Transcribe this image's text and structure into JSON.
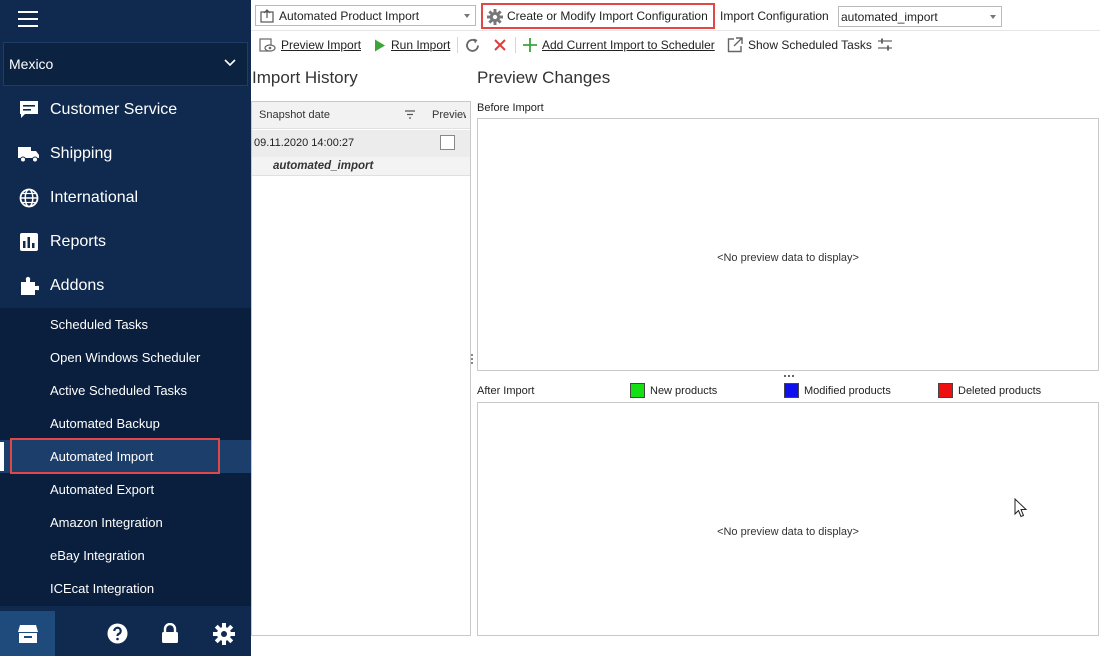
{
  "sidebar": {
    "store": "Mexico",
    "main_items": [
      {
        "label": "Customer Service",
        "icon": "chat-icon"
      },
      {
        "label": "Shipping",
        "icon": "truck-icon"
      },
      {
        "label": "International",
        "icon": "globe-icon"
      },
      {
        "label": "Reports",
        "icon": "bar-chart-icon"
      },
      {
        "label": "Addons",
        "icon": "puzzle-icon"
      }
    ],
    "sub_items": [
      {
        "label": "Scheduled Tasks"
      },
      {
        "label": "Open Windows Scheduler"
      },
      {
        "label": "Active Scheduled Tasks"
      },
      {
        "label": "Automated Backup"
      },
      {
        "label": "Automated Import"
      },
      {
        "label": "Automated Export"
      },
      {
        "label": "Amazon Integration"
      },
      {
        "label": "eBay Integration"
      },
      {
        "label": "ICEcat Integration"
      }
    ],
    "active_sub_item": "Automated Import",
    "bottom_icons": [
      "store-icon",
      "help-icon",
      "lock-icon",
      "gear-icon"
    ]
  },
  "toolbar": {
    "import_select": "Automated Product Import",
    "create_config_label": "Create or Modify Import Configuration",
    "import_config_label": "Import Configuration",
    "import_config_value": "automated_import",
    "preview_import_label": "Preview Import",
    "run_import_label": "Run Import",
    "add_scheduler_label": "Add Current Import to Scheduler",
    "show_tasks_label": "Show Scheduled Tasks"
  },
  "history": {
    "title": "Import History",
    "col_snapshot": "Snapshot date",
    "col_preview": "Preview",
    "row_date": "09.11.2020 14:00:27",
    "row_group": "automated_import"
  },
  "preview": {
    "title": "Preview Changes",
    "before_label": "Before Import",
    "after_label": "After Import",
    "empty_text": "<No preview data to display>",
    "legend": [
      {
        "label": "New products",
        "color": "#14e014"
      },
      {
        "label": "Modified products",
        "color": "#1010ee"
      },
      {
        "label": "Deleted products",
        "color": "#ee1010"
      }
    ]
  },
  "colors": {
    "sidebar_bg": "#0f2a4e",
    "highlight": "#e04848"
  }
}
